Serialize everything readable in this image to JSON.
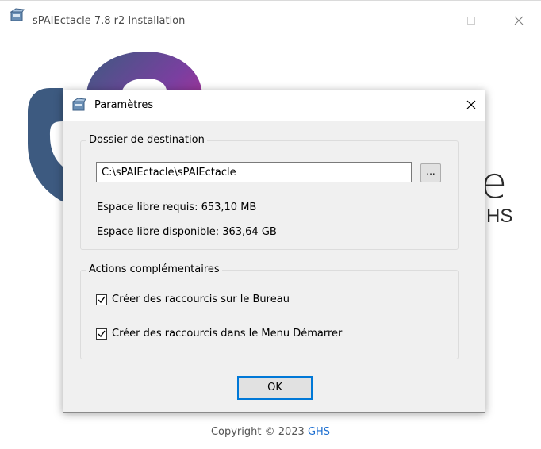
{
  "window": {
    "title": "sPAIEctacle 7.8 r2 Installation",
    "minimize_glyph": "—",
    "maximize_glyph": "☐",
    "close_glyph": "✕"
  },
  "branding": {
    "logo_letter_e": "e",
    "logo_ghs": "HS",
    "copyright_prefix": "Copyright © 2023 ",
    "copyright_brand": "GHS"
  },
  "dialog": {
    "title": "Paramètres",
    "close_glyph": "✕",
    "destination": {
      "legend": "Dossier de destination",
      "path_value": "C:\\sPAIEctacle\\sPAIEctacle",
      "browse_label": "...",
      "required_space": "Espace libre requis: 653,10 MB",
      "available_space": "Espace libre disponible: 363,64 GB"
    },
    "actions": {
      "legend": "Actions complémentaires",
      "options": [
        {
          "label": "Créer des raccourcis sur le Bureau",
          "checked": true
        },
        {
          "label": "Créer des raccourcis dans le Menu Démarrer",
          "checked": true
        }
      ]
    },
    "ok_label": "OK"
  },
  "colors": {
    "accent": "#0078d7",
    "brand_link": "#1e6fd0",
    "logo_gradient": [
      "#3d5a80",
      "#7a3fa0",
      "#d0248a"
    ]
  },
  "icons": {
    "app": "installer-box-icon",
    "dialog": "installer-box-icon",
    "checkbox": "checkmark-icon"
  }
}
